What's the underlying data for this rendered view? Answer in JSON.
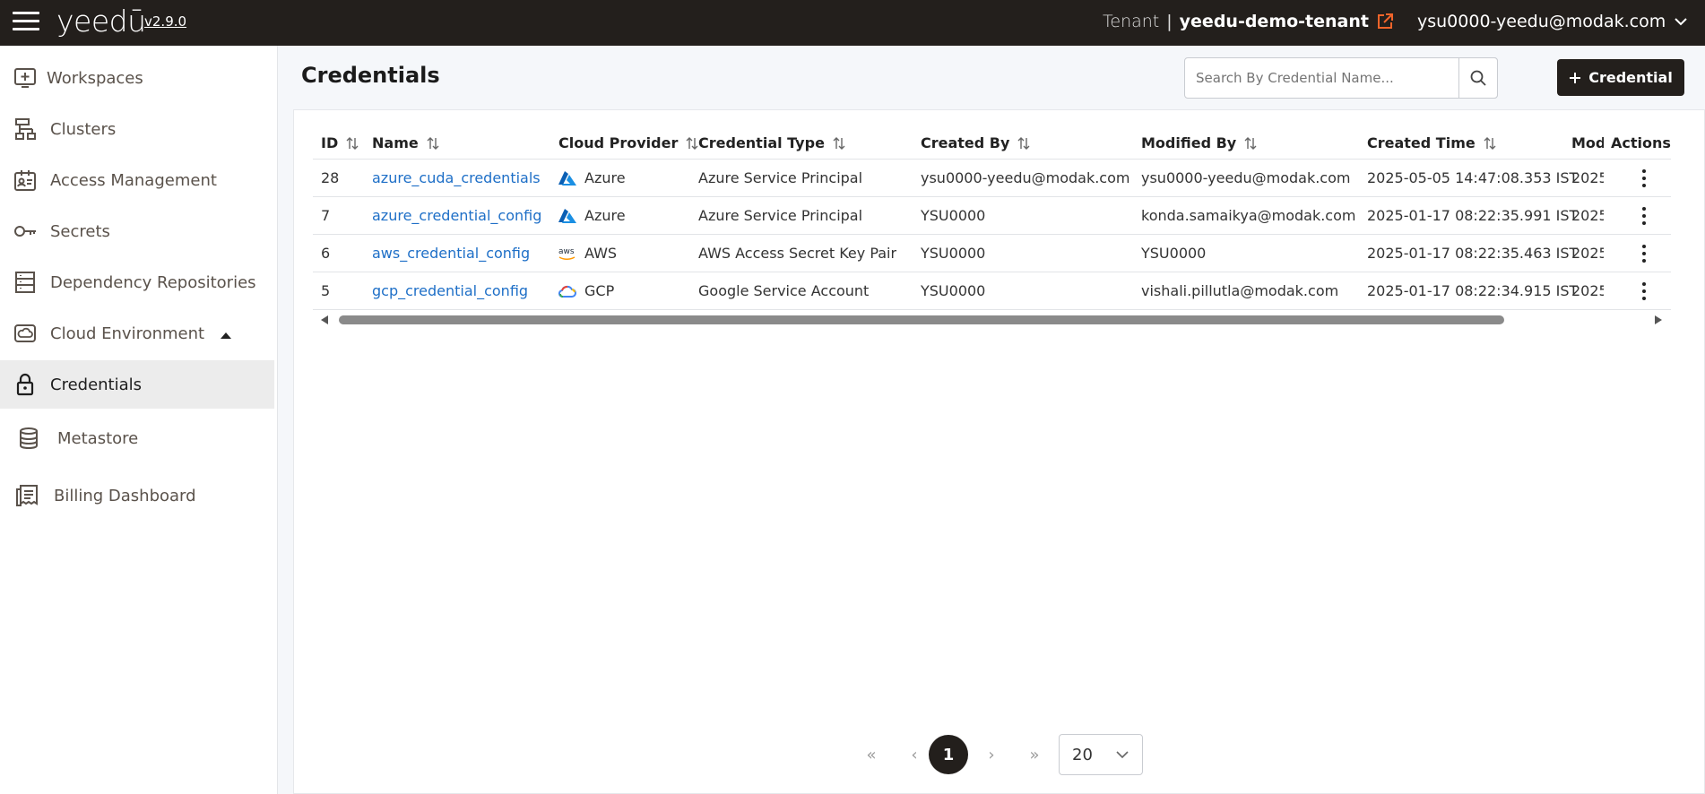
{
  "app": {
    "logo": "yeedū",
    "version": "v2.9.0",
    "tenant_label": "Tenant",
    "tenant_separator": "|",
    "tenant_name": "yeedu-demo-tenant",
    "user_email": "ysu0000-yeedu@modak.com",
    "accent_color": "#f0642a",
    "topbar_color": "#231f1c"
  },
  "sidebar": {
    "items": [
      {
        "label": "Workspaces",
        "icon": "workspace-plus-icon"
      },
      {
        "label": "Clusters",
        "icon": "cluster-network-icon"
      },
      {
        "label": "Access Management",
        "icon": "id-card-icon"
      },
      {
        "label": "Secrets",
        "icon": "key-icon"
      },
      {
        "label": "Dependency Repositories",
        "icon": "repository-icon"
      },
      {
        "label": "Cloud Environment",
        "icon": "cloud-icon"
      },
      {
        "label": "Credentials",
        "icon": "lock-icon"
      },
      {
        "label": "Metastore",
        "icon": "database-icon"
      },
      {
        "label": "Billing Dashboard",
        "icon": "billing-icon"
      }
    ]
  },
  "main": {
    "title": "Credentials",
    "search_placeholder": "Search By Credential Name...",
    "add_button_label": "Credential"
  },
  "table": {
    "columns": [
      "ID",
      "Name",
      "Cloud Provider",
      "Credential Type",
      "Created By",
      "Modified By",
      "Created Time",
      "Mod",
      "Actions"
    ],
    "rows": [
      {
        "id": "28",
        "name": "azure_cuda_credentials",
        "provider": "Azure",
        "type": "Azure Service Principal",
        "created_by": "ysu0000-yeedu@modak.com",
        "modified_by": "ysu0000-yeedu@modak.com",
        "created_time": "2025-05-05 14:47:08.353 IST",
        "mod": "2025"
      },
      {
        "id": "7",
        "name": "azure_credential_config",
        "provider": "Azure",
        "type": "Azure Service Principal",
        "created_by": "YSU0000",
        "modified_by": "konda.samaikya@modak.com",
        "created_time": "2025-01-17 08:22:35.991 IST",
        "mod": "2025"
      },
      {
        "id": "6",
        "name": "aws_credential_config",
        "provider": "AWS",
        "type": "AWS Access Secret Key Pair",
        "created_by": "YSU0000",
        "modified_by": "YSU0000",
        "created_time": "2025-01-17 08:22:35.463 IST",
        "mod": "2025"
      },
      {
        "id": "5",
        "name": "gcp_credential_config",
        "provider": "GCP",
        "type": "Google Service Account",
        "created_by": "YSU0000",
        "modified_by": "vishali.pillutla@modak.com",
        "created_time": "2025-01-17 08:22:34.915 IST",
        "mod": "2025"
      }
    ]
  },
  "pagination": {
    "first": "«",
    "prev": "‹",
    "current_page": "1",
    "next": "›",
    "last": "»",
    "page_size": "20"
  }
}
